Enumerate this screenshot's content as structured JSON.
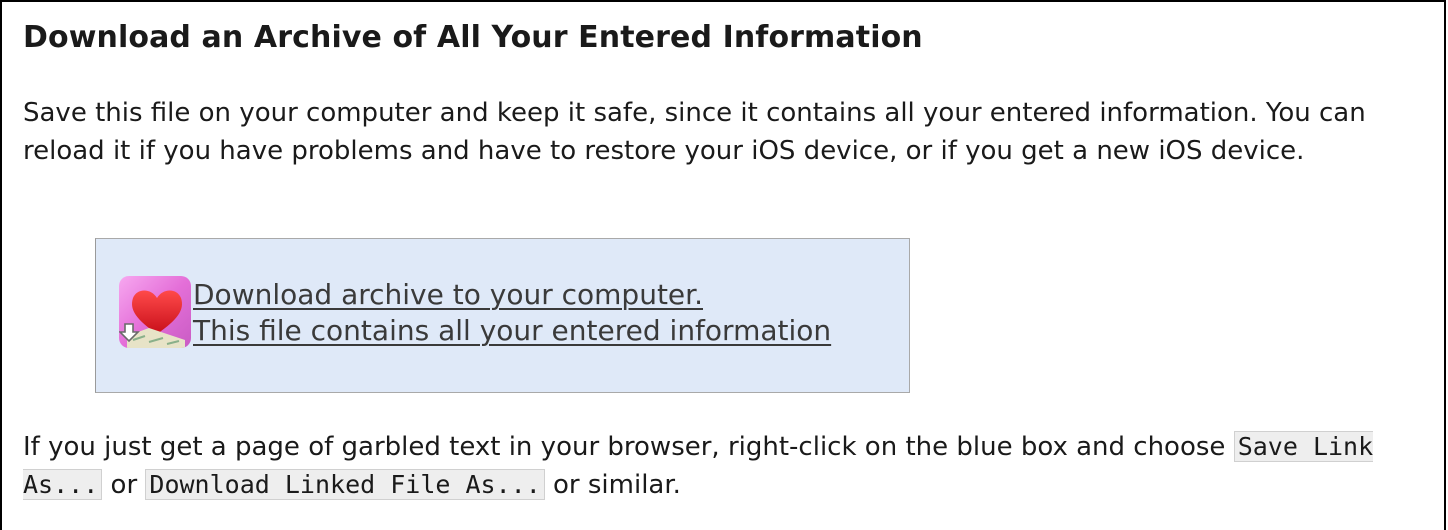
{
  "heading": "Download an Archive of All Your Entered Information",
  "intro": "Save this file on your computer and keep it safe, since it contains all your entered information. You can reload it if you have problems and have to restore your iOS device, or if you get a new iOS device.",
  "download": {
    "line1": "Download archive to your computer.",
    "line2": "This file contains all your entered information",
    "icon": "heart-download-app-icon",
    "box_color": "#dfe9f8"
  },
  "note": {
    "before": "If you just get a page of garbled text in your browser, right-click on the blue box and choose ",
    "option1": "Save Link As...",
    "middle": " or ",
    "option2": "Download Linked File As...",
    "after": " or similar."
  }
}
